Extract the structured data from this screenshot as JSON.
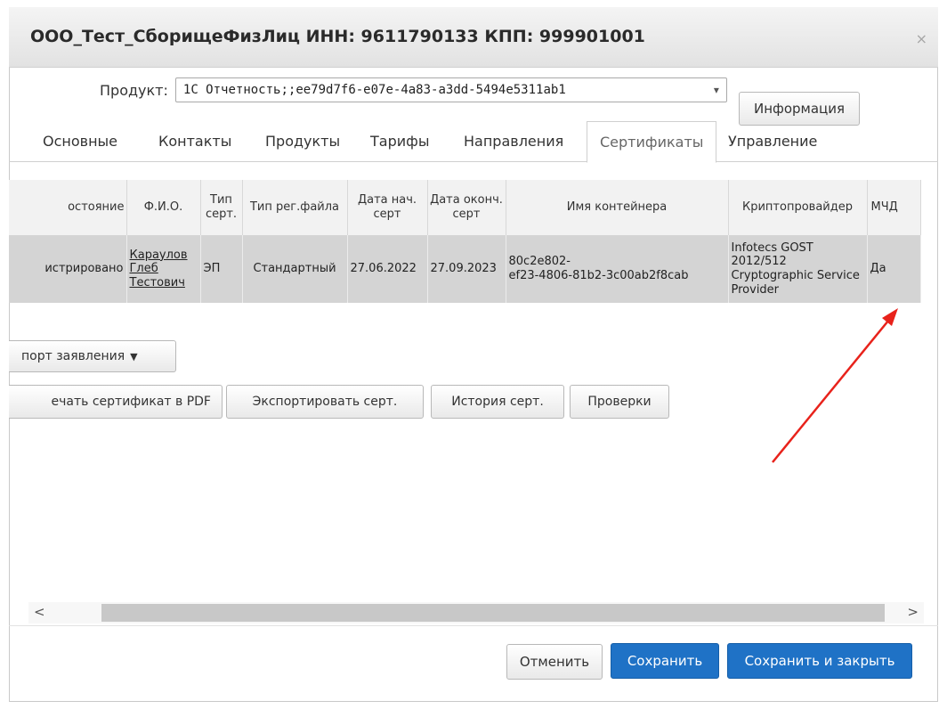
{
  "dialog": {
    "title": "ООО_Тест_СборищеФизЛиц ИНН: 9611790133 КПП: 999901001",
    "close_glyph": "×"
  },
  "product": {
    "label": "Продукт:",
    "selected": "1С Отчетность;;ee79d7f6-e07e-4a83-a3dd-5494e5311ab1",
    "info_button": "Информация"
  },
  "tabs": [
    {
      "label": "Основные"
    },
    {
      "label": "Контакты"
    },
    {
      "label": "Продукты"
    },
    {
      "label": "Тарифы"
    },
    {
      "label": "Направления"
    },
    {
      "label": "Сертификаты",
      "active": true
    },
    {
      "label": "Управление"
    }
  ],
  "table": {
    "headers": {
      "state": "остояние",
      "fio": "Ф.И.О.",
      "cert_type": "Тип серт.",
      "reg_type": "Тип рег.файла",
      "start": "Дата нач. серт",
      "end": "Дата оконч. серт",
      "container": "Имя контейнера",
      "crypto": "Криптопровайдер",
      "mchd": "МЧД"
    },
    "row": {
      "state": "истрировано",
      "fio_surname": "Караулов",
      "fio_name": "Глеб",
      "fio_patronymic": "Тестович",
      "cert_type": "ЭП",
      "reg_type": "Стандартный",
      "start": "27.06.2022",
      "end": "27.09.2023",
      "container_line1": "80c2e802-",
      "container_line2": "ef23-4806-81b2-3c00ab2f8cab",
      "crypto": "Infotecs GOST 2012/512 Cryptographic Service Provider",
      "mchd": "Да"
    }
  },
  "actions": {
    "export_dropdown": "порт заявления",
    "print_pdf": "ечать сертификат в PDF",
    "export_cert": "Экспортировать серт.",
    "history": "История серт.",
    "checks": "Проверки"
  },
  "scrollbar": {
    "left_glyph": "<",
    "right_glyph": ">"
  },
  "footer": {
    "cancel": "Отменить",
    "save": "Сохранить",
    "save_close": "Сохранить и закрыть"
  },
  "colors": {
    "primary": "#1f72c6",
    "selected_row": "#d4d4d4",
    "annotation_arrow": "#e8221b"
  }
}
